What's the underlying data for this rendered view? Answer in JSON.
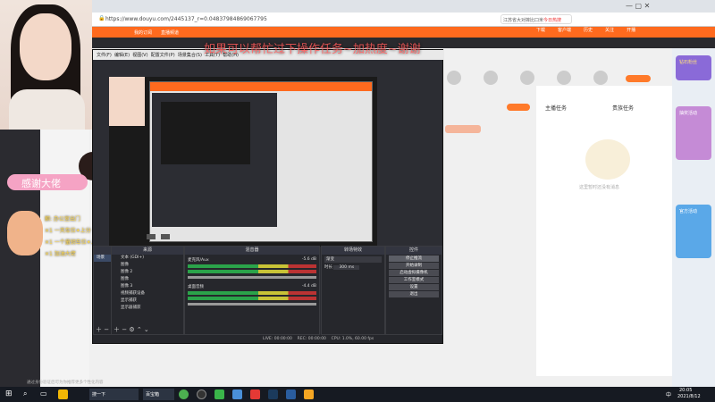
{
  "browser": {
    "url": "https://www.douyu.com/2445137_r=0.04837984869067795",
    "search_text": "江苏省大对摔比口米",
    "search_badge": "今日热搜",
    "nav_items": [
      "下载",
      "客户端",
      "历史",
      "关注",
      "开播"
    ]
  },
  "site": {
    "header_items": [
      "我的订阅",
      "直播频道"
    ],
    "page_link": "请看看"
  },
  "banner": {
    "text": "如果可以帮忙过下操作任务~加热度~谢谢"
  },
  "obs": {
    "menu": [
      "文件(F)",
      "编辑(E)",
      "视图(V)",
      "配置文件(P)",
      "场景集合(S)",
      "工具(T)",
      "帮助(H)"
    ],
    "sections": {
      "scenes": "场景",
      "sources": "来源",
      "mixer": "混音器",
      "transitions": "转场特效",
      "controls": "控件"
    },
    "scene_item": "场景",
    "sources": [
      "文本 (GDI+)",
      "图像",
      "图像 2",
      "图像",
      "图像 3",
      "视频捕获设备",
      "显示捕获",
      "显示器捕获"
    ],
    "mixer": [
      {
        "name": "麦克风/Aux",
        "db": "-5.6 dB"
      },
      {
        "name": "桌面音频",
        "db": "-4.4 dB"
      }
    ],
    "transition": {
      "type": "渐变",
      "duration_label": "时长",
      "duration_value": "300 ms"
    },
    "controls": [
      "停止推流",
      "开始录制",
      "启动虚拟摄像机",
      "工作室模式",
      "设置",
      "退出"
    ],
    "statusbar": {
      "live": "LIVE: 00:00:00",
      "rec": "REC: 00:00:00",
      "cpu": "CPU: 1.0%, 60.00 fps"
    }
  },
  "overlay": {
    "thanks": "感谢大佬",
    "gifts": [
      "麒: 办公室出门",
      "✕1 一天车位✦上分",
      "✕1 一个童钥车位✦上分",
      "✕1 加油大佬"
    ]
  },
  "right_panel": {
    "tabs": [
      "主播任务",
      "贵族任务"
    ],
    "empty_text": "这里暂时还没有消息"
  },
  "sidebar_cards": [
    "钻石粉丝",
    "抽奖活动",
    "官方活动"
  ],
  "taskbar": {
    "items": [
      "搜一下",
      "百宝箱"
    ],
    "time": "20:05",
    "date": "2021/8/12",
    "ime": "中",
    "bottom_notice": "通过身份验证后可为你推荐更多个性化内容"
  },
  "colors": {
    "brand": "#ff6a1e",
    "obs_bg": "#2c2d33",
    "taskbar": "#161a22"
  }
}
